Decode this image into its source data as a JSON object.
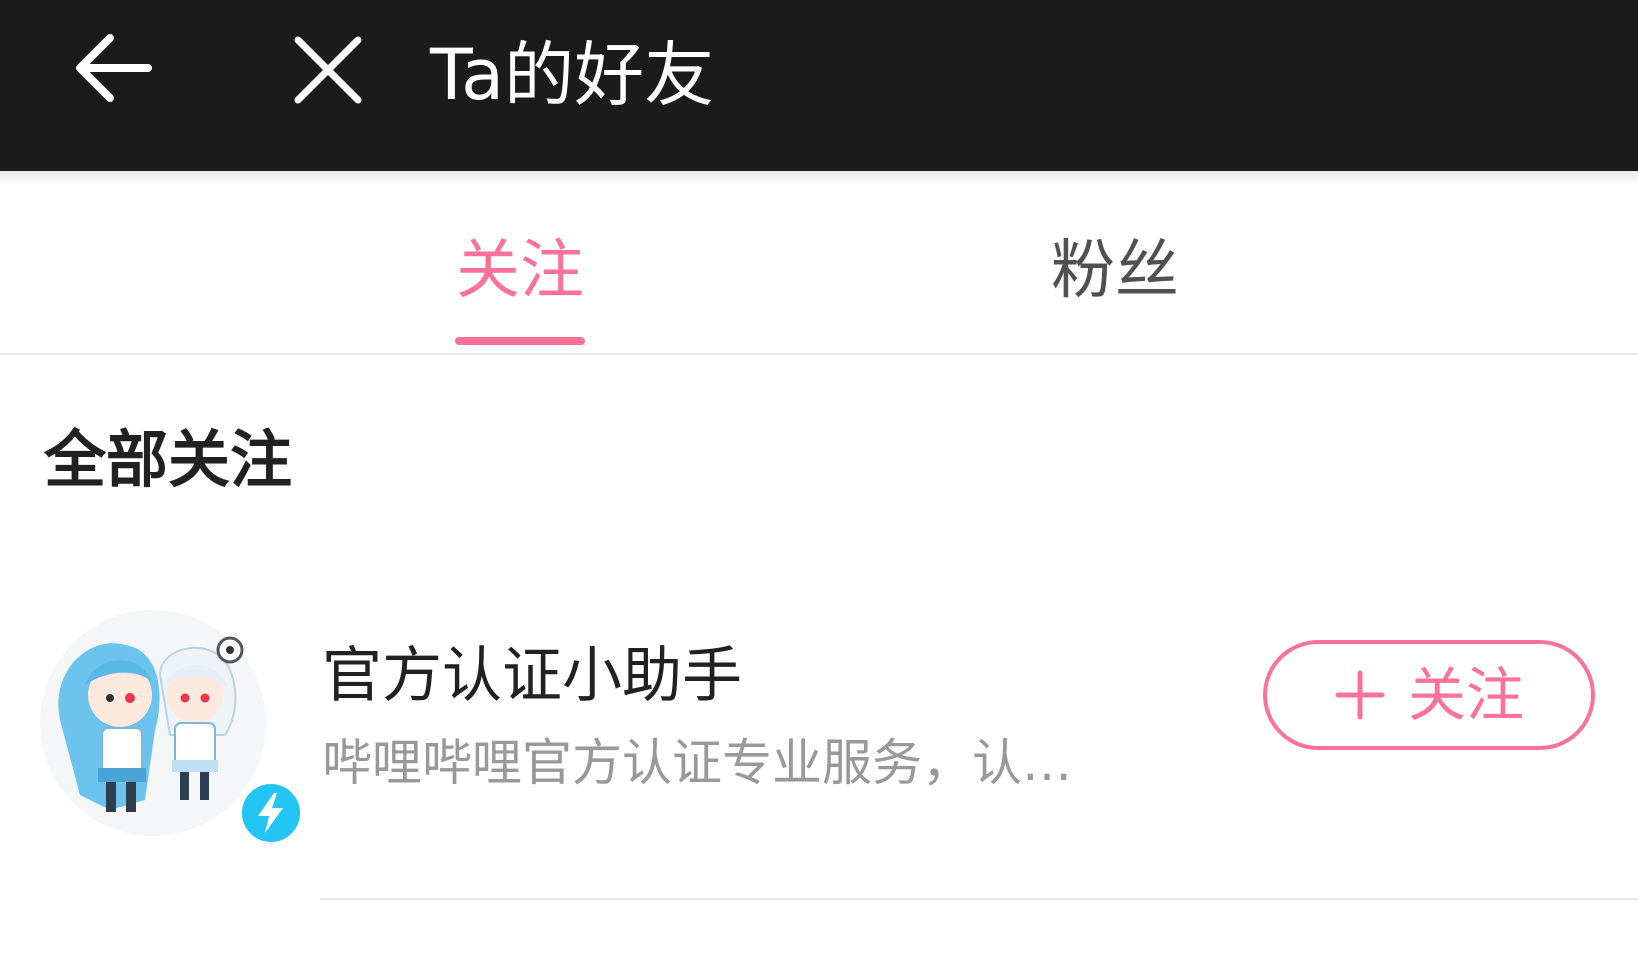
{
  "header": {
    "title": "Ta的好友",
    "back_icon": "arrow-left-icon",
    "close_icon": "close-icon"
  },
  "tabs": [
    {
      "label": "关注",
      "active": true
    },
    {
      "label": "粉丝",
      "active": false
    }
  ],
  "section": {
    "title": "全部关注"
  },
  "following_list": [
    {
      "name": "官方认证小助手",
      "description": "哔哩哔哩官方认证专业服务，认…",
      "avatar_icon": "anime-characters-avatar",
      "badge_icon": "lightning-verified-icon",
      "follow_label": "关注"
    }
  ],
  "colors": {
    "accent": "#fb7299",
    "header_bg": "#1b1b1b",
    "badge": "#23c5f5",
    "muted_text": "#999999"
  }
}
